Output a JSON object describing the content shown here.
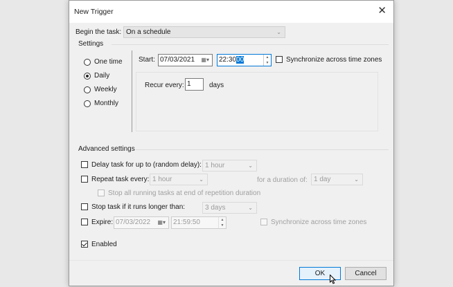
{
  "dialog": {
    "title": "New Trigger"
  },
  "begin_task": {
    "label": "Begin the task:",
    "value": "On a schedule"
  },
  "settings": {
    "label": "Settings",
    "schedule_options": [
      {
        "label": "One time",
        "checked": false
      },
      {
        "label": "Daily",
        "checked": true
      },
      {
        "label": "Weekly",
        "checked": false
      },
      {
        "label": "Monthly",
        "checked": false
      }
    ],
    "start_label": "Start:",
    "start_date": "07/03/2021",
    "start_time_prefix": "22:30",
    "start_time_selected": "00",
    "sync_label": "Synchronize across time zones",
    "recur_label": "Recur every:",
    "recur_value": "1",
    "recur_unit": "days"
  },
  "advanced": {
    "label": "Advanced settings",
    "delay_label": "Delay task for up to (random delay):",
    "delay_value": "1 hour",
    "repeat_label": "Repeat task every:",
    "repeat_value": "1 hour",
    "duration_label": "for a duration of:",
    "duration_value": "1 day",
    "stop_running_label": "Stop all running tasks at end of repetition duration",
    "stop_longer_label": "Stop task if it runs longer than:",
    "stop_longer_value": "3 days",
    "expire_label": "Expire:",
    "expire_date": "07/03/2022",
    "expire_time": "21:59:50",
    "expire_sync_label": "Synchronize across time zones",
    "enabled_label": "Enabled"
  },
  "buttons": {
    "ok": "OK",
    "cancel": "Cancel"
  },
  "icons": {
    "close": "close-icon",
    "dropdown": "chevron-down-icon",
    "calendar": "calendar-icon",
    "spin": "spin-arrows-icon",
    "cursor": "mouse-pointer-icon"
  }
}
